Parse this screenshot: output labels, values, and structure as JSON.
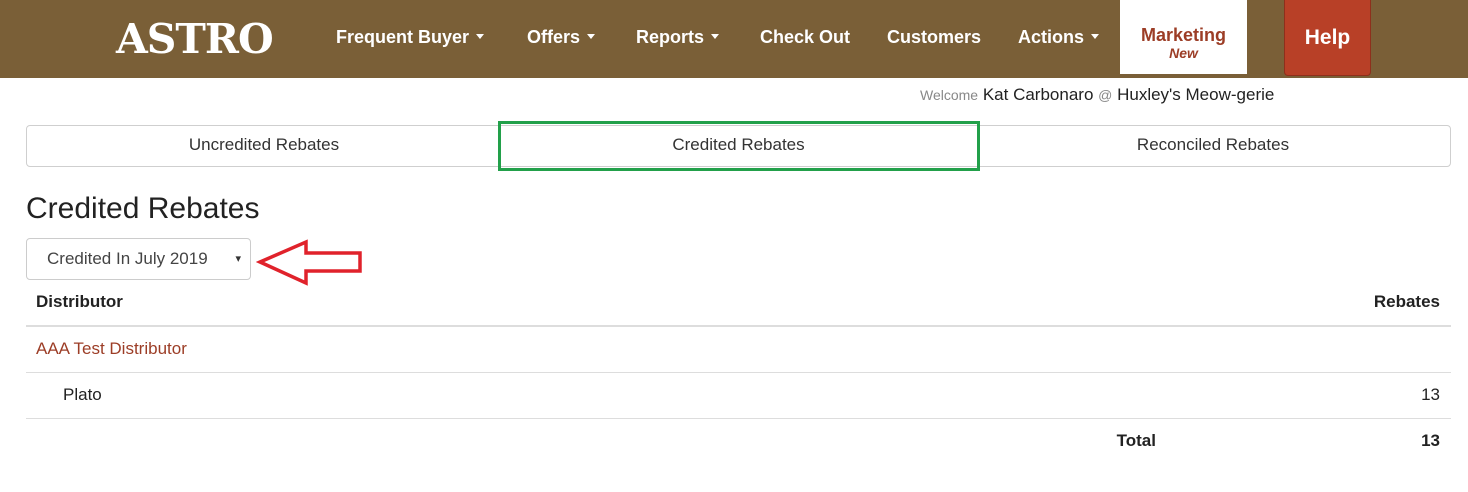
{
  "brand": {
    "logo_text": "ASTRO"
  },
  "nav": {
    "frequent_buyer": "Frequent Buyer",
    "offers": "Offers",
    "reports": "Reports",
    "check_out": "Check Out",
    "customers": "Customers",
    "actions": "Actions",
    "marketing": "Marketing",
    "marketing_badge": "New",
    "help": "Help"
  },
  "welcome": {
    "prefix": "Welcome",
    "user": "Kat Carbonaro",
    "at": "@",
    "store": "Huxley's Meow-gerie"
  },
  "tabs": {
    "uncredited": "Uncredited Rebates",
    "credited": "Credited Rebates",
    "reconciled": "Reconciled Rebates",
    "active": "Credited Rebates"
  },
  "page": {
    "title": "Credited Rebates"
  },
  "filter": {
    "selected": "Credited In July 2019",
    "arrow": "▾"
  },
  "table": {
    "headers": {
      "distributor": "Distributor",
      "rebates": "Rebates"
    },
    "groups": [
      {
        "distributor": "AAA Test Distributor",
        "rows": [
          {
            "name": "Plato",
            "rebates": "13"
          }
        ]
      }
    ],
    "total_label": "Total",
    "total_value": "13"
  },
  "colors": {
    "navbar": "#7a5f37",
    "help": "#b84027",
    "link": "#9c3d26",
    "active_tab_outline": "#22a04a",
    "annotation_arrow": "#e0222b"
  }
}
